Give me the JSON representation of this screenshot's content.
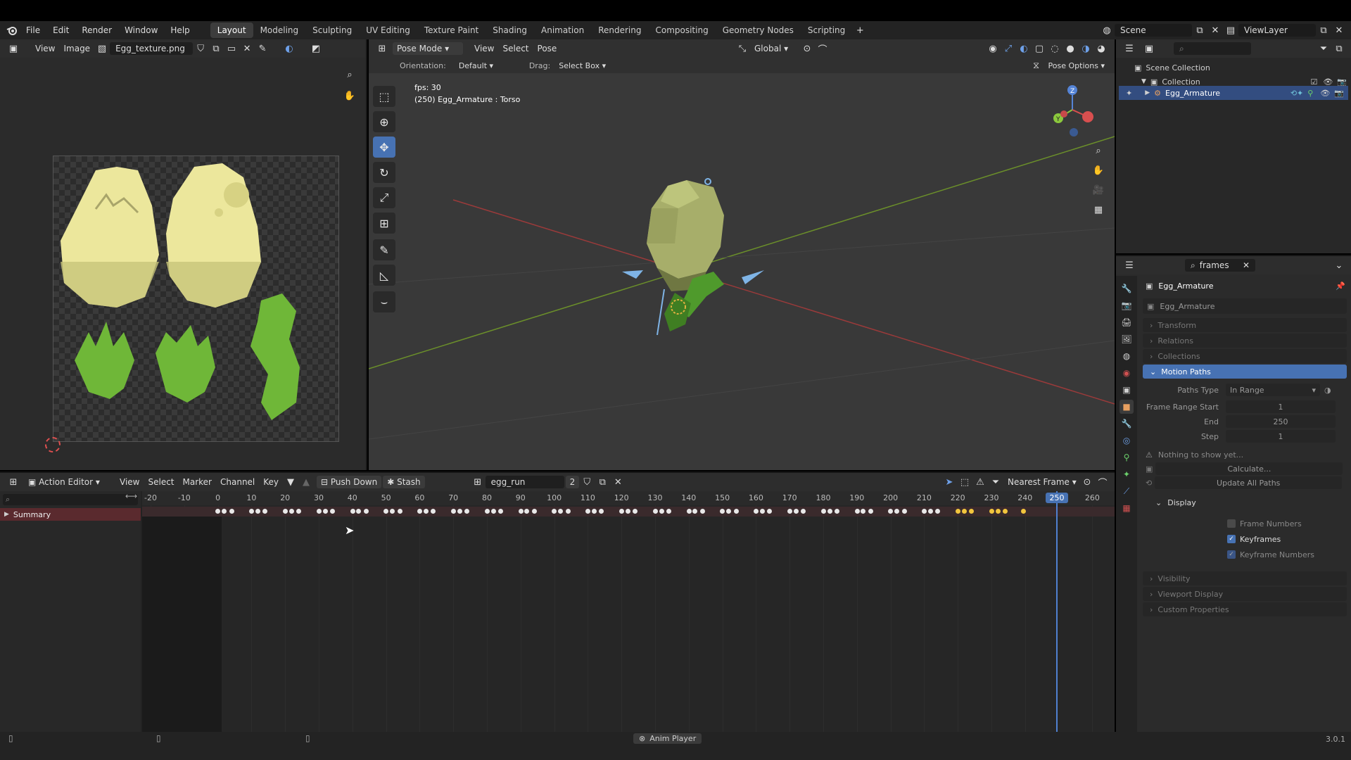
{
  "top_menu": {
    "items": [
      "File",
      "Edit",
      "Render",
      "Window",
      "Help"
    ],
    "workspaces": [
      "Layout",
      "Modeling",
      "Sculpting",
      "UV Editing",
      "Texture Paint",
      "Shading",
      "Animation",
      "Rendering",
      "Compositing",
      "Geometry Nodes",
      "Scripting"
    ],
    "active_workspace": "Layout",
    "scene": "Scene",
    "view_layer": "ViewLayer"
  },
  "image_editor": {
    "menu": [
      "View",
      "Image"
    ],
    "image_name": "Egg_texture.png"
  },
  "viewport": {
    "mode": "Pose Mode",
    "menu": [
      "View",
      "Select",
      "Pose"
    ],
    "transform_orientation": "Global",
    "orientation_label": "Orientation:",
    "orientation_value": "Default",
    "drag_label": "Drag:",
    "drag_value": "Select Box",
    "pose_options": "Pose Options",
    "fps_text": "fps: 30",
    "info_text": "(250) Egg_Armature : Torso",
    "gizmo": {
      "x": "X",
      "y": "Y",
      "z": "Z"
    }
  },
  "outliner": {
    "scene_collection": "Scene Collection",
    "collection": "Collection",
    "object": "Egg_Armature"
  },
  "properties": {
    "search": "frames",
    "object_name": "Egg_Armature",
    "data_name": "Egg_Armature",
    "panels_collapsed_top": [
      "Transform",
      "Relations",
      "Collections"
    ],
    "motion_paths": {
      "title": "Motion Paths",
      "paths_type_label": "Paths Type",
      "paths_type_value": "In Range",
      "frame_range_start_label": "Frame Range Start",
      "frame_range_start": "1",
      "end_label": "End",
      "end": "250",
      "step_label": "Step",
      "step": "1",
      "nothing_msg": "Nothing to show yet...",
      "calculate": "Calculate...",
      "update_all": "Update All Paths",
      "display_title": "Display",
      "frame_numbers": "Frame Numbers",
      "keyframes": "Keyframes",
      "keyframe_numbers": "Keyframe Numbers",
      "frame_numbers_checked": false,
      "keyframes_checked": true,
      "keyframe_numbers_checked": true
    },
    "panels_collapsed_bottom": [
      "Visibility",
      "Viewport Display",
      "Custom Properties"
    ]
  },
  "action_editor": {
    "editor_type": "Action Editor",
    "menu": [
      "View",
      "Select",
      "Marker",
      "Channel",
      "Key"
    ],
    "push_down": "Push Down",
    "stash": "Stash",
    "action_name": "egg_run",
    "users": "2",
    "snapping": "Nearest Frame",
    "summary": "Summary",
    "current_frame": "250",
    "ruler_ticks": [
      "-20",
      "-10",
      "0",
      "10",
      "20",
      "30",
      "40",
      "50",
      "60",
      "70",
      "80",
      "90",
      "100",
      "110",
      "120",
      "130",
      "140",
      "150",
      "160",
      "170",
      "180",
      "190",
      "200",
      "210",
      "220",
      "230",
      "240",
      "250",
      "260"
    ]
  },
  "status_bar": {
    "center": "Anim Player",
    "version": "3.0.1"
  },
  "colors": {
    "accent_blue": "#4772b3",
    "summary_red": "#5a2a2e",
    "keyframe_white": "#e8e8e8",
    "keyframe_selected": "#f2c53d"
  }
}
